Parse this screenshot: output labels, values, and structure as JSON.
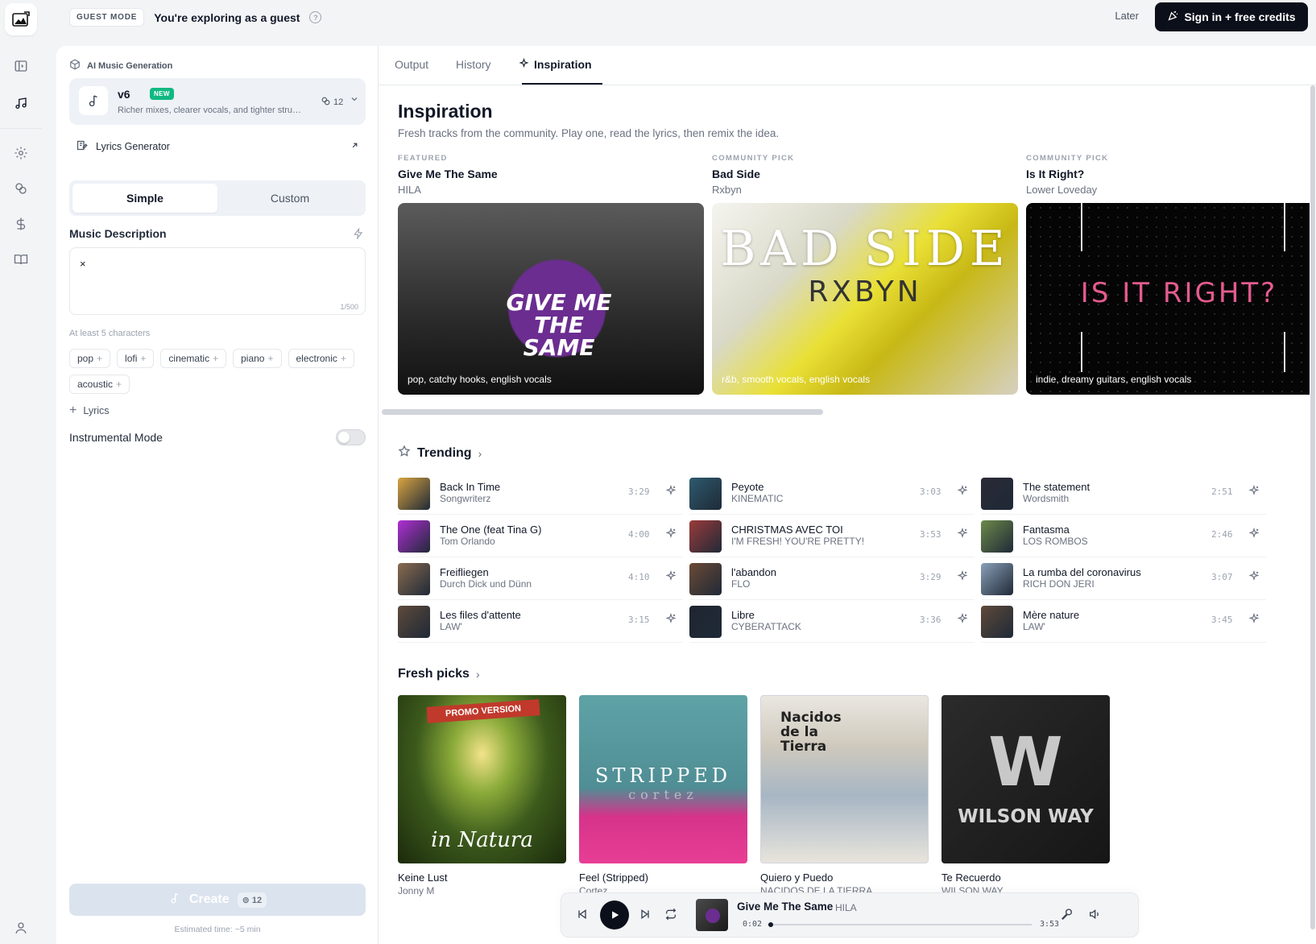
{
  "topbar": {
    "guest_badge": "GUEST MODE",
    "guest_text": "You're exploring as a guest",
    "help_glyph": "?",
    "later_label": "Later",
    "signin_label": "Sign in + free credits"
  },
  "rail": {
    "icons": [
      "app-logo-icon",
      "sidebar-toggle-icon",
      "music-note-icon",
      "gear-icon",
      "coins-icon",
      "dollar-icon",
      "book-icon",
      "user-icon"
    ]
  },
  "panel": {
    "header": "AI Music Generation",
    "model": {
      "name": "v6",
      "badge": "NEW",
      "description": "Richer mixes, clearer vocals, and tighter structure",
      "credits": "12"
    },
    "lyrics_generator": "Lyrics Generator",
    "modes": [
      "Simple",
      "Custom"
    ],
    "active_mode": "Simple",
    "description_label": "Music Description",
    "description_value": "×",
    "char_count": "1/500",
    "hint": "At least 5 characters",
    "tags": [
      "pop",
      "lofi",
      "cinematic",
      "piano",
      "electronic",
      "acoustic"
    ],
    "tag_plus": "+",
    "add_lyrics": "Lyrics",
    "add_lyrics_plus": "+",
    "instrumental_label": "Instrumental Mode",
    "instrumental_on": false,
    "create_label": "Create",
    "create_credits": "12",
    "estimate": "Estimated time: ~5 min"
  },
  "main": {
    "tabs": [
      "Output",
      "History",
      "Inspiration"
    ],
    "active_tab": "Inspiration",
    "title": "Inspiration",
    "subtitle": "Fresh tracks from the community. Play one, read the lyrics, then remix the idea.",
    "featured": [
      {
        "kicker": "FEATURED",
        "title": "Give Me The Same",
        "artist": "HILA",
        "caption": "pop, catchy hooks, english vocals",
        "art_text": "GIVE ME THE SAME"
      },
      {
        "kicker": "COMMUNITY PICK",
        "title": "Bad Side",
        "artist": "Rxbyn",
        "caption": "r&b, smooth vocals, english vocals",
        "art_text": "BAD SIDE",
        "art_text2": "RXBYN"
      },
      {
        "kicker": "COMMUNITY PICK",
        "title": "Is It Right?",
        "artist": "Lower Loveday",
        "caption": "indie, dreamy guitars, english vocals",
        "art_text": "IS IT RIGHT?"
      }
    ],
    "trending_title": "Trending",
    "trending": [
      [
        {
          "title": "Back In Time",
          "artist": "Songwriterz",
          "duration": "3:29",
          "thumb": "#d9a441"
        },
        {
          "title": "The One (feat Tina G)",
          "artist": "Tom Orlando",
          "duration": "4:00",
          "thumb": "#b12fd6"
        },
        {
          "title": "Freifliegen",
          "artist": "Durch Dick und Dünn",
          "duration": "4:10",
          "thumb": "#8a6b4f"
        },
        {
          "title": "Les files d'attente",
          "artist": "LAW'",
          "duration": "3:15",
          "thumb": "#5e4a3a"
        }
      ],
      [
        {
          "title": "Peyote",
          "artist": "KINEMATIC",
          "duration": "3:03",
          "thumb": "#2d5b6e"
        },
        {
          "title": "CHRISTMAS AVEC TOI",
          "artist": "I'M FRESH! YOU'RE PRETTY!",
          "duration": "3:53",
          "thumb": "#9b3b3b"
        },
        {
          "title": "l'abandon",
          "artist": "FLO",
          "duration": "3:29",
          "thumb": "#6b4a35"
        },
        {
          "title": "Libre",
          "artist": "CYBERATTACK",
          "duration": "3:36",
          "thumb": "#1f2630"
        }
      ],
      [
        {
          "title": "The statement",
          "artist": "Wordsmith",
          "duration": "2:51",
          "thumb": "#2a2a35"
        },
        {
          "title": "Fantasma",
          "artist": "LOS ROMBOS",
          "duration": "2:46",
          "thumb": "#6c8a4a"
        },
        {
          "title": "La rumba del coronavirus",
          "artist": "RICH DON JERI",
          "duration": "3:07",
          "thumb": "#8aa0b8"
        },
        {
          "title": "Mère nature",
          "artist": "LAW'",
          "duration": "3:45",
          "thumb": "#5e4a3a"
        }
      ]
    ],
    "fresh_title": "Fresh picks",
    "fresh": [
      {
        "title": "Keine Lust",
        "artist": "Jonny M",
        "art_text": "in Natura",
        "badge": "PROMO VERSION"
      },
      {
        "title": "Feel (Stripped)",
        "artist": "Cortez",
        "art_text": "STRIPPED",
        "art_text2": "cortez"
      },
      {
        "title": "Quiero y Puedo",
        "artist": "NACIDOS DE LA TIERRA",
        "art_text": "Nacidos de la Tierra"
      },
      {
        "title": "Te Recuerdo",
        "artist": "WILSON WAY",
        "art_text": "WILSON WAY",
        "art_text2": "W"
      }
    ]
  },
  "player": {
    "title": "Give Me The Same",
    "artist": "HILA",
    "current": "0:02",
    "duration": "3:53",
    "progress_fraction": 0.009
  }
}
